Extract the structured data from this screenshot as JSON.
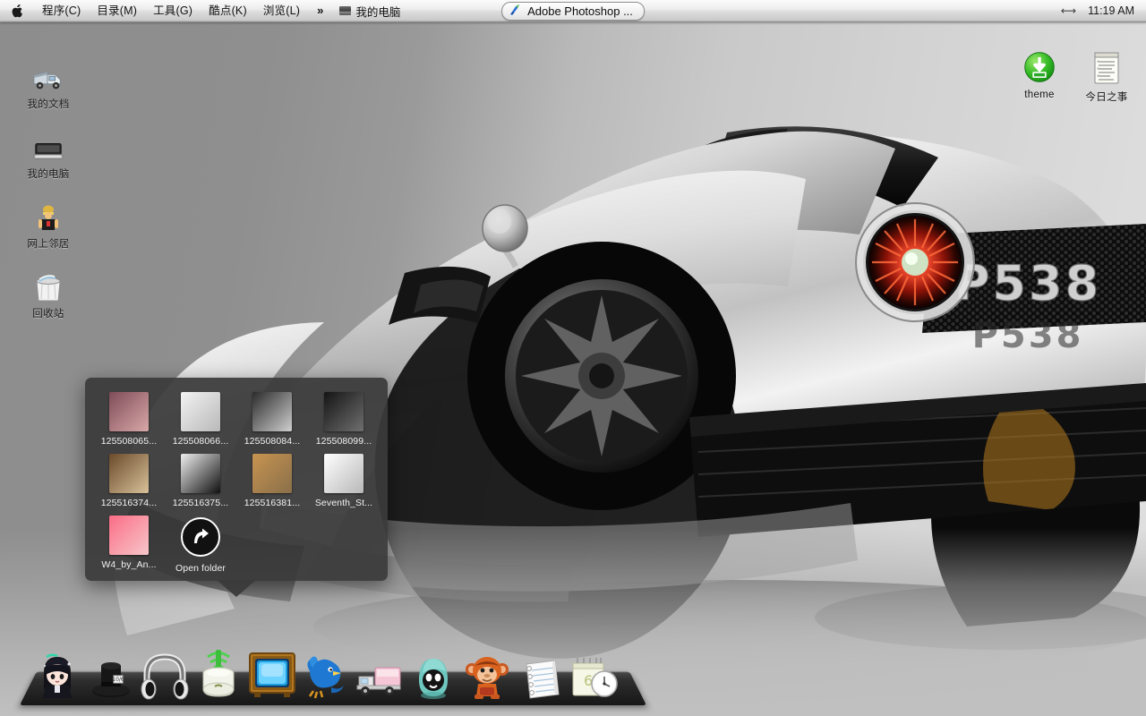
{
  "menubar": {
    "apple_icon": "apple-logo-icon",
    "items": [
      {
        "label": "程序(C)",
        "name": "menu-programs"
      },
      {
        "label": "目录(M)",
        "name": "menu-catalog"
      },
      {
        "label": "工具(G)",
        "name": "menu-tools"
      },
      {
        "label": "酷点(K)",
        "name": "menu-kudian"
      },
      {
        "label": "浏览(L)",
        "name": "menu-browse"
      },
      {
        "label": "»",
        "name": "menu-overflow"
      }
    ],
    "my_computer": "我的电脑",
    "active_app": "Adobe Photoshop ...",
    "active_app_icon": "photoshop-feather-icon",
    "arrows_icon": "resize-arrows-icon",
    "clock": "11:19 AM"
  },
  "desktop_icons": [
    {
      "label": "我的文档",
      "icon": "delivery-truck-icon",
      "name": "desktop-icon-my-documents"
    },
    {
      "label": "我的电脑",
      "icon": "computer-icon",
      "name": "desktop-icon-my-computer"
    },
    {
      "label": "网上邻居",
      "icon": "network-person-icon",
      "name": "desktop-icon-network-neighborhood"
    },
    {
      "label": "回收站",
      "icon": "recycle-bin-icon",
      "name": "desktop-icon-recycle-bin"
    },
    {
      "label": "theme",
      "icon": "green-download-icon",
      "name": "desktop-icon-theme"
    },
    {
      "label": "今日之事",
      "icon": "notepad-list-icon",
      "name": "desktop-icon-today-tasks"
    }
  ],
  "stack": {
    "open_folder_label": "Open folder",
    "open_folder_icon": "open-folder-arrow-icon",
    "files": [
      {
        "name": "125508065...",
        "color1": "#7e4c58",
        "color2": "#d9a8a8"
      },
      {
        "name": "125508066...",
        "color1": "#f2f2f2",
        "color2": "#b9b9b9"
      },
      {
        "name": "125508084...",
        "color1": "#2b2b2b",
        "color2": "#cfcfcf"
      },
      {
        "name": "125508099...",
        "color1": "#141414",
        "color2": "#6f6f6f"
      },
      {
        "name": "125516374...",
        "color1": "#6b4a2a",
        "color2": "#d8c29a"
      },
      {
        "name": "125516375...",
        "color1": "#efefef",
        "color2": "#101010"
      },
      {
        "name": "125516381...",
        "color1": "#c79450",
        "color2": "#8a6f4a"
      },
      {
        "name": "Seventh_St...",
        "color1": "#ffffff",
        "color2": "#b8b8b8"
      },
      {
        "name": "W4_by_An...",
        "color1": "#fb6d86",
        "color2": "#f7c6c9"
      }
    ]
  },
  "dock": {
    "items": [
      {
        "label": "anime-girl",
        "icon": "anime-girl-icon",
        "name": "dock-item-anime-girl"
      },
      {
        "label": "top-hat",
        "icon": "top-hat-icon",
        "name": "dock-item-top-hat"
      },
      {
        "label": "headphones",
        "icon": "headphones-icon",
        "name": "dock-item-headphones"
      },
      {
        "label": "rice-cooker",
        "icon": "rice-cooker-wifi-icon",
        "name": "dock-item-rice-cooker"
      },
      {
        "label": "television",
        "icon": "retro-tv-icon",
        "name": "dock-item-television"
      },
      {
        "label": "twitter",
        "icon": "twitter-bird-icon",
        "name": "dock-item-twitter"
      },
      {
        "label": "truck",
        "icon": "delivery-truck-icon",
        "name": "dock-item-truck"
      },
      {
        "label": "egg-character",
        "icon": "teal-egg-icon",
        "name": "dock-item-egg-character"
      },
      {
        "label": "monkey",
        "icon": "monkey-icon",
        "name": "dock-item-monkey"
      },
      {
        "label": "notepad",
        "icon": "notepad-icon",
        "name": "dock-item-notepad"
      },
      {
        "label": "calendar-clock",
        "icon": "calendar-clock-icon",
        "name": "dock-item-calendar-clock"
      }
    ]
  },
  "wallpaper": {
    "badge_text": "P538",
    "description": "silver sports car rear three-quarter"
  }
}
